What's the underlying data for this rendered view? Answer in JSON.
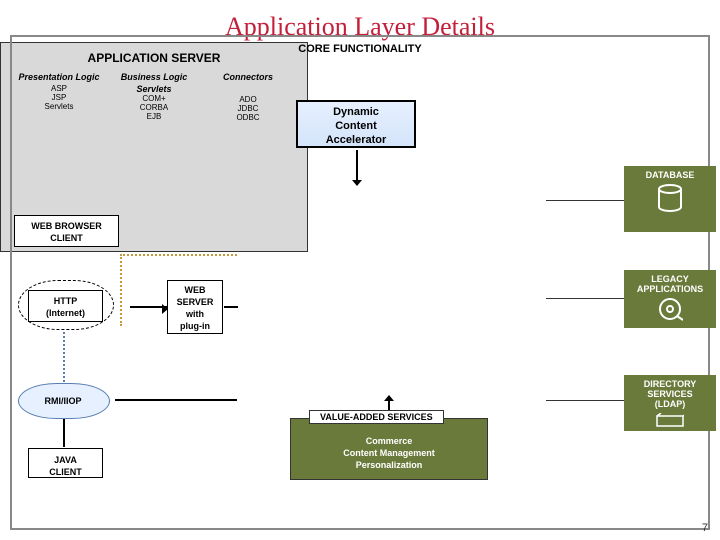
{
  "slide": {
    "title": "Application Layer Details",
    "pageNumber": "7"
  },
  "nodes": {
    "dca": {
      "line1": "Dynamic",
      "line2": "Content",
      "line3": "Accelerator"
    },
    "webBrowserClient": {
      "line1": "WEB BROWSER",
      "line2": "CLIENT"
    },
    "http": {
      "line1": "HTTP",
      "line2": "(Internet)"
    },
    "webServer": {
      "line1": "WEB",
      "line2": "SERVER",
      "line3": "with",
      "line4": "plug-in"
    },
    "rmi": "RMI/IIOP",
    "javaClient": {
      "line1": "JAVA",
      "line2": "CLIENT"
    }
  },
  "appServer": {
    "title": "APPLICATION SERVER",
    "core": {
      "title": "CORE FUNCTIONALITY",
      "columns": [
        {
          "header": "Presentation Logic",
          "sub": "",
          "items": [
            "ASP",
            "JSP",
            "Servlets"
          ]
        },
        {
          "header": "Business Logic",
          "sub": "Servlets",
          "items": [
            "COM+",
            "CORBA",
            "EJB"
          ]
        },
        {
          "header": "Connectors",
          "sub": "",
          "items": [
            "ADO",
            "JDBC",
            "ODBC"
          ]
        }
      ]
    }
  },
  "vas": {
    "title": "VALUE-ADDED SERVICES",
    "items": [
      "Commerce",
      "Content Management",
      "Personalization"
    ]
  },
  "sidebar": {
    "database": "DATABASE",
    "legacy": "LEGACY APPLICATIONS",
    "directory": {
      "line1": "DIRECTORY",
      "line2": "SERVICES",
      "line3": "(LDAP)"
    }
  }
}
